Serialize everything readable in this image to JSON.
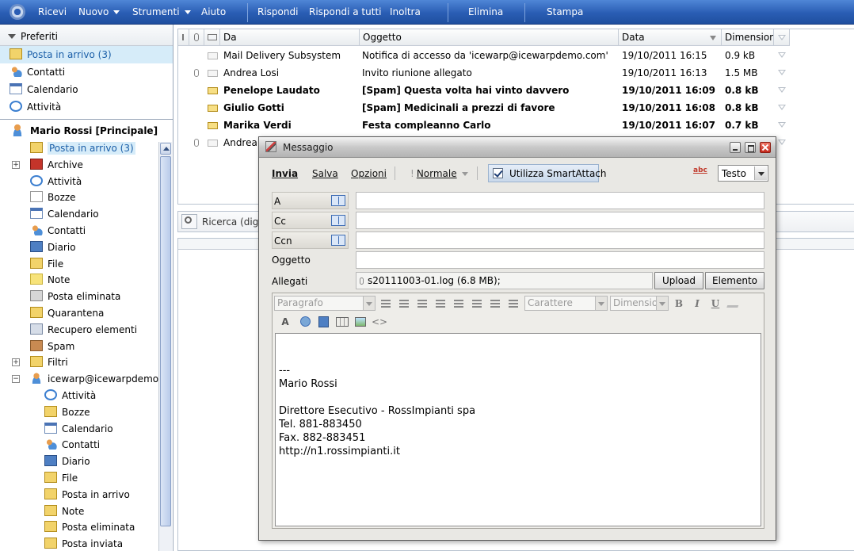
{
  "toolbar": {
    "items": [
      "Ricevi",
      "Nuovo",
      "Strumenti",
      "Aiuto",
      "Rispondi",
      "Rispondi a tutti",
      "Inoltra",
      "Elimina",
      "Stampa"
    ]
  },
  "favorites": {
    "header": "Preferiti",
    "items": [
      {
        "label": "Posta in arrivo",
        "count": "(3)"
      },
      {
        "label": "Contatti"
      },
      {
        "label": "Calendario"
      },
      {
        "label": "Attività"
      }
    ]
  },
  "tree": {
    "account1": "Mario Rossi [Principale]",
    "folders1": [
      {
        "label": "Posta in arrivo",
        "count": "(3)"
      },
      {
        "label": "Archive"
      },
      {
        "label": "Attività"
      },
      {
        "label": "Bozze"
      },
      {
        "label": "Calendario"
      },
      {
        "label": "Contatti"
      },
      {
        "label": "Diario"
      },
      {
        "label": "File"
      },
      {
        "label": "Note"
      },
      {
        "label": "Posta eliminata"
      },
      {
        "label": "Quarantena"
      },
      {
        "label": "Recupero elementi"
      },
      {
        "label": "Spam"
      },
      {
        "label": "Filtri"
      }
    ],
    "account2": "icewarp@icewarpdemo.c",
    "folders2": [
      {
        "label": "Attività"
      },
      {
        "label": "Bozze"
      },
      {
        "label": "Calendario"
      },
      {
        "label": "Contatti"
      },
      {
        "label": "Diario"
      },
      {
        "label": "File"
      },
      {
        "label": "Posta in arrivo"
      },
      {
        "label": "Note"
      },
      {
        "label": "Posta eliminata"
      },
      {
        "label": "Posta inviata"
      }
    ]
  },
  "list": {
    "headers": {
      "from": "Da",
      "subject": "Oggetto",
      "date": "Data",
      "size": "Dimensioni"
    },
    "rows": [
      {
        "from": "Mail Delivery Subsystem",
        "subject": "Notifica di accesso da 'icewarp@icewarpdemo.com'",
        "date": "19/10/2011 16:15",
        "size": "0.9 kB",
        "bold": false,
        "attach": false
      },
      {
        "from": "Andrea Losi",
        "subject": "Invito riunione allegato",
        "date": "19/10/2011 16:13",
        "size": "1.5 MB",
        "bold": false,
        "attach": true
      },
      {
        "from": "Penelope Laudato",
        "subject": "[Spam] Questa volta hai vinto davvero",
        "date": "19/10/2011 16:09",
        "size": "0.8 kB",
        "bold": true,
        "attach": false
      },
      {
        "from": "Giulio Gotti",
        "subject": "[Spam] Medicinali a prezzi di favore",
        "date": "19/10/2011 16:08",
        "size": "0.8 kB",
        "bold": true,
        "attach": false
      },
      {
        "from": "Marika Verdi",
        "subject": "Festa compleanno Carlo",
        "date": "19/10/2011 16:07",
        "size": "0.7 kB",
        "bold": true,
        "attach": false
      },
      {
        "from": "Andrea L",
        "subject": "",
        "date": "",
        "size": "",
        "bold": false,
        "attach": true
      }
    ]
  },
  "search": {
    "placeholder": "Ricerca (digi"
  },
  "dialog": {
    "title": "Messaggio",
    "send": "Invia",
    "save": "Salva",
    "options": "Opzioni",
    "priority": "Normale",
    "smartattach": "Utilizza SmartAttach",
    "format": "Testo",
    "to_label": "A",
    "cc_label": "Cc",
    "bcc_label": "Ccn",
    "subject_label": "Oggetto",
    "attachments_label": "Allegati",
    "attachment": "s20111003-01.log (6.8 MB);",
    "upload": "Upload",
    "item": "Elemento",
    "editor": {
      "paragraph": "Paragrafo",
      "font": "Carattere",
      "size": "Dimension"
    },
    "signature": [
      "---",
      "Mario Rossi",
      "",
      "Direttore Esecutivo - RossImpianti spa",
      "Tel. 881-883450",
      "Fax. 882-883451",
      "http://n1.rossimpianti.it"
    ]
  }
}
